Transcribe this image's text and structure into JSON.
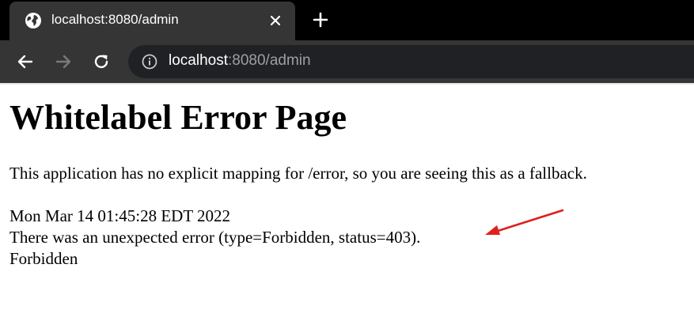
{
  "browser": {
    "tab": {
      "title": "localhost:8080/admin",
      "icon": "globe-icon"
    },
    "toolbar": {
      "url_host": "localhost",
      "url_rest": ":8080/admin"
    }
  },
  "page": {
    "heading": "Whitelabel Error Page",
    "description": "This application has no explicit mapping for /error, so you are seeing this as a fallback.",
    "timestamp": "Mon Mar 14 01:45:28 EDT 2022",
    "error_message": "There was an unexpected error (type=Forbidden, status=403).",
    "error_detail": "Forbidden"
  },
  "annotation": {
    "arrow_color": "#e0201a"
  }
}
